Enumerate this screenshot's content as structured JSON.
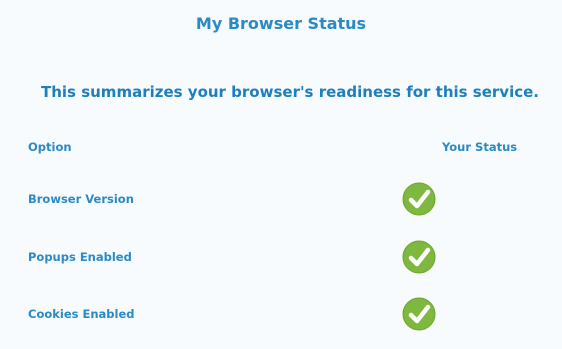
{
  "page": {
    "title": "My Browser Status",
    "summary": "This summarizes your browser's readiness for this service."
  },
  "table": {
    "columns": {
      "option": "Option",
      "status": "Your Status"
    },
    "rows": [
      {
        "label": "Browser Version",
        "status_icon": "check-circle-icon",
        "status": "ok"
      },
      {
        "label": "Popups Enabled",
        "status_icon": "check-circle-icon",
        "status": "ok"
      },
      {
        "label": "Cookies Enabled",
        "status_icon": "check-circle-icon",
        "status": "ok"
      }
    ]
  },
  "colors": {
    "accent": "#2a8ac3",
    "check_green": "#7fb83f",
    "background": "#f7fbfd"
  }
}
